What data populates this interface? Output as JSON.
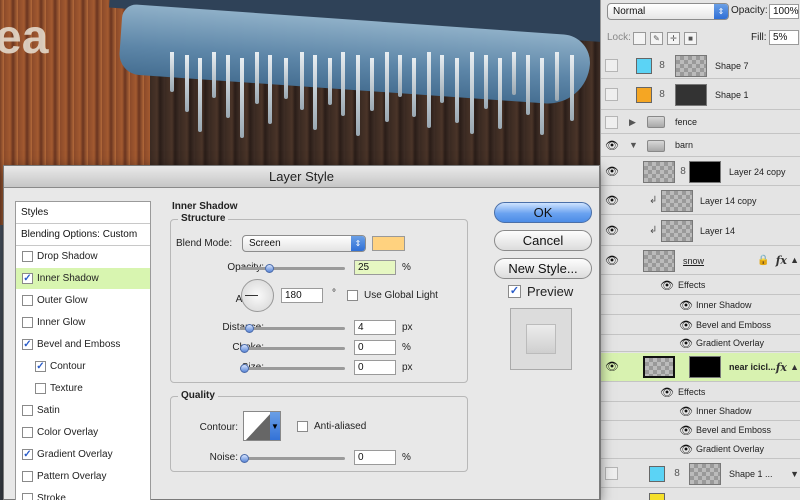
{
  "dialog": {
    "title": "Layer Style",
    "styles_list": {
      "header": "Styles",
      "blending_options": "Blending Options: Custom",
      "items": [
        {
          "label": "Drop Shadow",
          "checked": false,
          "selected": false,
          "indent": false
        },
        {
          "label": "Inner Shadow",
          "checked": true,
          "selected": true,
          "indent": false
        },
        {
          "label": "Outer Glow",
          "checked": false,
          "selected": false,
          "indent": false
        },
        {
          "label": "Inner Glow",
          "checked": false,
          "selected": false,
          "indent": false
        },
        {
          "label": "Bevel and Emboss",
          "checked": true,
          "selected": false,
          "indent": false
        },
        {
          "label": "Contour",
          "checked": true,
          "selected": false,
          "indent": true
        },
        {
          "label": "Texture",
          "checked": false,
          "selected": false,
          "indent": true
        },
        {
          "label": "Satin",
          "checked": false,
          "selected": false,
          "indent": false
        },
        {
          "label": "Color Overlay",
          "checked": false,
          "selected": false,
          "indent": false
        },
        {
          "label": "Gradient Overlay",
          "checked": true,
          "selected": false,
          "indent": false
        },
        {
          "label": "Pattern Overlay",
          "checked": false,
          "selected": false,
          "indent": false
        },
        {
          "label": "Stroke",
          "checked": false,
          "selected": false,
          "indent": false
        }
      ]
    },
    "section_title": "Inner Shadow",
    "structure": {
      "title": "Structure",
      "blend_mode_label": "Blend Mode:",
      "blend_mode_value": "Screen",
      "blend_color": "#ffd27f",
      "opacity_label": "Opacity:",
      "opacity_value": "25",
      "opacity_unit": "%",
      "angle_label": "Angle:",
      "angle_value": "180",
      "angle_unit": "°",
      "use_global_light_label": "Use Global Light",
      "use_global_light_checked": false,
      "distance_label": "Distance:",
      "distance_value": "4",
      "distance_unit": "px",
      "choke_label": "Choke:",
      "choke_value": "0",
      "choke_unit": "%",
      "size_label": "Size:",
      "size_value": "0",
      "size_unit": "px"
    },
    "quality": {
      "title": "Quality",
      "contour_label": "Contour:",
      "anti_aliased_label": "Anti-aliased",
      "anti_aliased_checked": false,
      "noise_label": "Noise:",
      "noise_value": "0",
      "noise_unit": "%"
    },
    "buttons": {
      "ok": "OK",
      "cancel": "Cancel",
      "new_style": "New Style...",
      "preview_label": "Preview",
      "preview_checked": true
    }
  },
  "layers_panel": {
    "blend_mode": "Normal",
    "opacity_label": "Opacity:",
    "opacity_value": "100%",
    "lock_label": "Lock:",
    "fill_label": "Fill:",
    "fill_value": "5%",
    "layers": [
      {
        "name": "Shape 7",
        "visible": false,
        "swatch": "#5bd3f5"
      },
      {
        "name": "Shape 1",
        "visible": false,
        "swatch": "#f5a623"
      },
      {
        "name": "fence",
        "visible": false,
        "type": "folder",
        "expanded": false
      },
      {
        "name": "barn",
        "visible": true,
        "type": "folder",
        "expanded": true
      },
      {
        "name": "Layer 24 copy",
        "visible": true
      },
      {
        "name": "Layer 14 copy",
        "visible": true
      },
      {
        "name": "Layer 14",
        "visible": true
      },
      {
        "name": "snow",
        "visible": true,
        "fx": true,
        "effects": [
          "Effects",
          "Inner Shadow",
          "Bevel and Emboss",
          "Gradient Overlay"
        ]
      },
      {
        "name": "near icicl...",
        "visible": true,
        "fx": true,
        "selected": true,
        "effects": [
          "Effects",
          "Inner Shadow",
          "Bevel and Emboss",
          "Gradient Overlay"
        ]
      },
      {
        "name": "Shape 1 ...",
        "visible": false,
        "swatch": "#5bd3f5"
      }
    ],
    "fx_symbol": "fx"
  },
  "canvas": {
    "visible_letter": "ea"
  },
  "icons": {
    "eye": "👁",
    "check": "✓",
    "chain": "8",
    "scroll_up": "▲",
    "scroll_down": "▼",
    "triangle_right": "▶",
    "triangle_down": "▼",
    "select_arrows": "⇕"
  }
}
